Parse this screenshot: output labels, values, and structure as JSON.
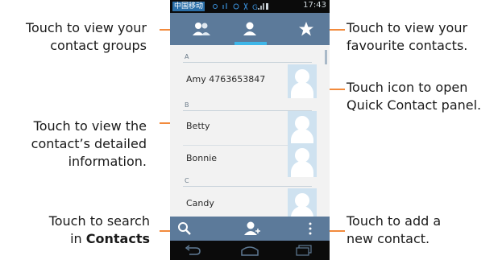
{
  "callouts": {
    "groups_line1": "Touch to view your",
    "groups_line2": "contact groups",
    "detail_line1": "Touch to view the",
    "detail_line2": "contact’s detailed",
    "detail_line3": "information.",
    "search_line1": "Touch to search",
    "search_in": "in ",
    "search_contacts": "Contacts",
    "favourite_line1": "Touch to view your",
    "favourite_line2": "favourite contacts.",
    "quick_line1": "Touch icon to open",
    "quick_line2": "Quick Contact panel.",
    "add_line1": "Touch to add a",
    "add_line2": "new contact."
  },
  "phone": {
    "carrier": "中国移动",
    "clock": "17:43",
    "sections": [
      "A",
      "B",
      "C"
    ],
    "contacts": [
      "Amy 4763653847",
      "Betty",
      "Bonnie",
      "Candy"
    ]
  },
  "colors": {
    "accent_line": "#f28a3c",
    "action_bar": "#5c7a9a",
    "tab_indicator": "#3fb6e8"
  },
  "icons": {
    "groups_tab": "groups-icon",
    "contacts_tab": "person-icon",
    "favourites_tab": "star-icon",
    "search": "search-icon",
    "add_contact": "add-contact-icon",
    "overflow": "overflow-menu-icon",
    "nav_back": "back-icon",
    "nav_home": "home-icon",
    "nav_recents": "recents-icon"
  }
}
